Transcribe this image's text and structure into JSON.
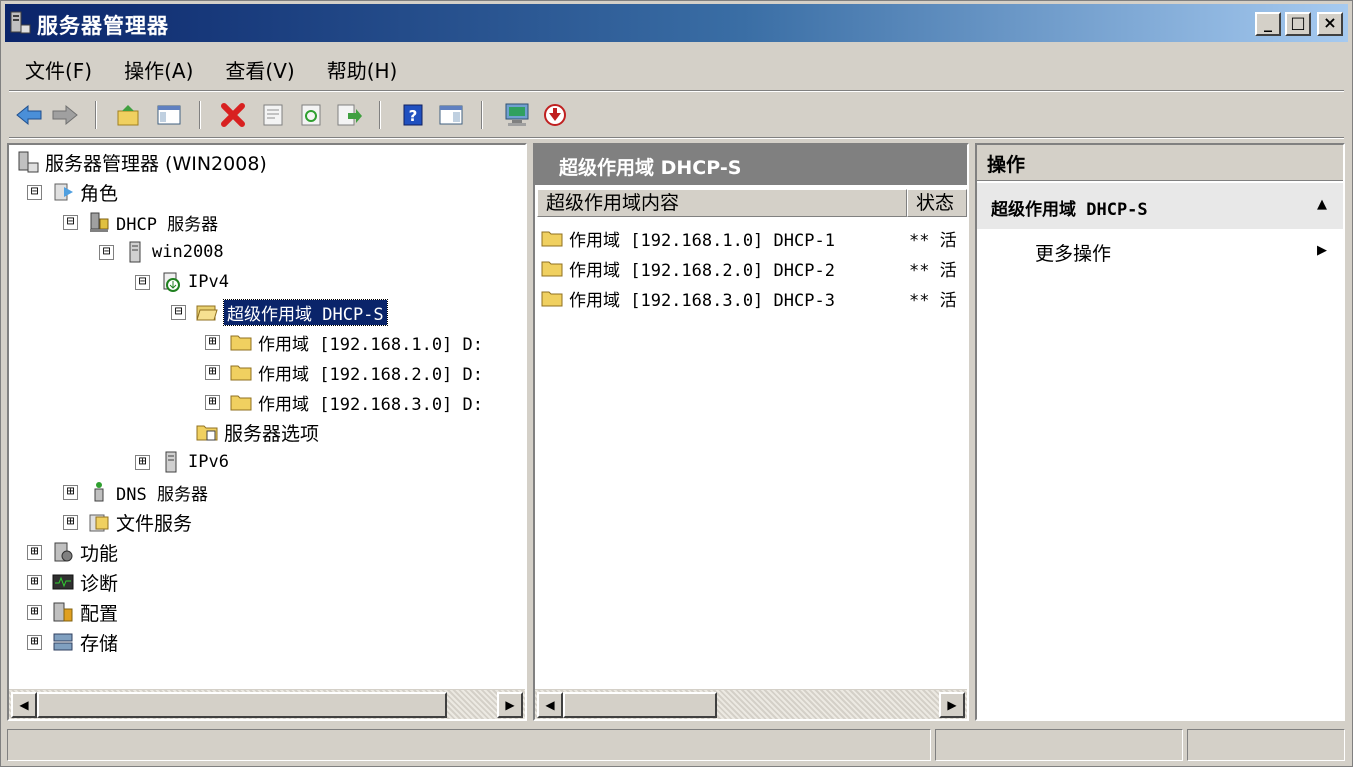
{
  "window": {
    "title": "服务器管理器",
    "minimize": "_",
    "maximize": "□",
    "close": "×"
  },
  "menu": [
    "文件(F)",
    "操作(A)",
    "查看(V)",
    "帮助(H)"
  ],
  "toolbar": {
    "icons": [
      "back-icon",
      "forward-icon",
      "up-folder-icon",
      "show-hide-tree-icon",
      "delete-icon",
      "properties-icon",
      "refresh-icon",
      "export-list-icon",
      "help-icon",
      "show-action-pane-icon",
      "computer-icon",
      "down-arrow-icon"
    ]
  },
  "tree": {
    "root": "服务器管理器 (WIN2008)",
    "roles": "角色",
    "dhcp": "DHCP 服务器",
    "server": "win2008",
    "ipv4": "IPv4",
    "superscope": "超级作用域 DHCP-S",
    "scope1": "作用域 [192.168.1.0] D:",
    "scope2": "作用域 [192.168.2.0] D:",
    "scope3": "作用域 [192.168.3.0] D:",
    "server_options": "服务器选项",
    "ipv6": "IPv6",
    "dns": "DNS 服务器",
    "file_services": "文件服务",
    "features": "功能",
    "diagnostics": "诊断",
    "configuration": "配置",
    "storage": "存储",
    "expanded": "⊟",
    "collapsed": "⊞"
  },
  "list": {
    "title": "超级作用域 DHCP-S",
    "columns": [
      "超级作用域内容",
      "状态"
    ],
    "rows": [
      {
        "name": "作用域 [192.168.1.0] DHCP-1",
        "status": "** 活"
      },
      {
        "name": "作用域 [192.168.2.0] DHCP-2",
        "status": "** 活"
      },
      {
        "name": "作用域 [192.168.3.0] DHCP-3",
        "status": "** 活"
      }
    ]
  },
  "actions": {
    "header": "操作",
    "section": "超级作用域 DHCP-S",
    "section_arrow": "▲",
    "more": "更多操作",
    "more_arrow": "▶"
  },
  "scroll": {
    "left": "◀",
    "right": "▶"
  },
  "colors": {
    "selection": "#0a246a",
    "title_start": "#0a246a",
    "title_end": "#a6caf0",
    "pane_header": "#808080"
  }
}
